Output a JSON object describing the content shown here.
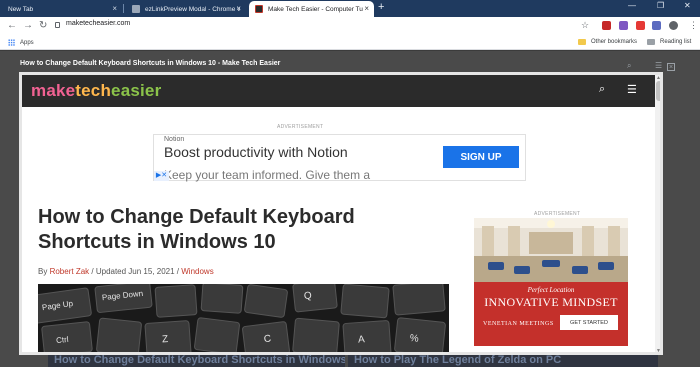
{
  "browser": {
    "tabs": [
      {
        "label": "New Tab",
        "close": "×"
      },
      {
        "label": "ezLinkPreview Modal - Chrome W",
        "close": "×"
      },
      {
        "label": "Make Tech Easier - Computer Tu",
        "close": "×"
      }
    ],
    "new_tab": "+",
    "window_controls": {
      "minimize": "—",
      "maximize": "❐",
      "close": "✕"
    },
    "nav": {
      "back": "←",
      "forward": "→",
      "reload": "↻"
    },
    "address": "maketecheasier.com",
    "star": "☆",
    "menu": "⋮",
    "bookmarks_bar": {
      "apps": "Apps",
      "other": "Other bookmarks",
      "reading": "Reading list"
    }
  },
  "background_page": {
    "headline": "How to Change Default Keyboard Shortcuts in Windows 10 - Make Tech Easier",
    "bottom_links": [
      "How to Change Default Keyboard Shortcuts in Windows",
      "How to Play The Legend of Zelda on PC"
    ]
  },
  "modal": {
    "logo": {
      "part1": "make",
      "part2": "tech",
      "part3": "easier"
    },
    "search_icon": "⌕",
    "menu_icon": "☰",
    "ad_label": "ADVERTISEMENT",
    "ad": {
      "brand": "Notion",
      "headline": "Boost productivity with Notion",
      "sub": "Keep your team informed. Give them a",
      "cta": "SIGN UP"
    },
    "article": {
      "title": "How to Change Default Keyboard Shortcuts in Windows 10",
      "by": "By",
      "author": "Robert Zak",
      "updated": "/ Updated Jun 15, 2021 /",
      "category": "Windows"
    },
    "side_ad": {
      "label": "ADVERTISEMENT",
      "pre": "Perfect Location",
      "headline": "INNOVATIVE MINDSET",
      "brand": "VENETIAN MEETINGS",
      "cta": "GET STARTED"
    }
  },
  "keys": [
    "Page Down",
    "Page Up",
    "Ctrl",
    "Q",
    "C",
    "A",
    "Z",
    "%"
  ]
}
